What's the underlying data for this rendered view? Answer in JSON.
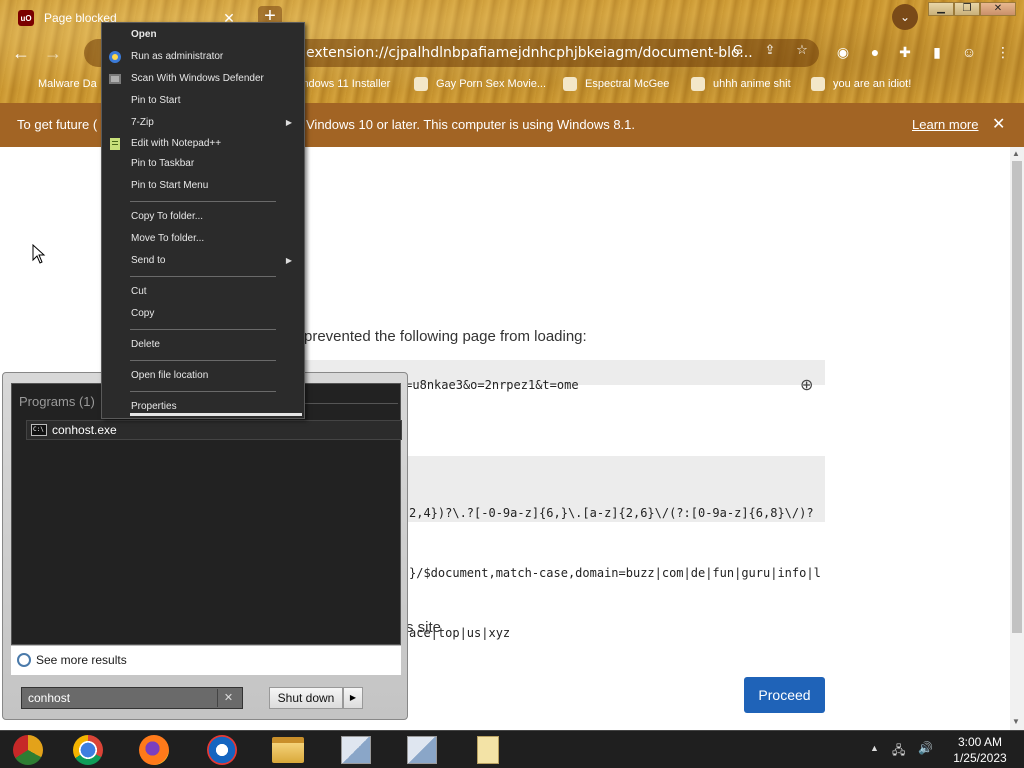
{
  "browser": {
    "tab_title": "Page blocked",
    "tab_icon": "uBlock Origin",
    "new_tab_label": "+",
    "address": "extension://cjpalhdlnbpafiamejdnhcphjbkeiagm/document-blo...",
    "bookmarks": [
      "Malware Da",
      "indows 11 Installer",
      "Gay Porn Sex Movie...",
      "Espectral McGee",
      "uhhh anime shit",
      "you are an idiot!"
    ]
  },
  "infobar": {
    "text_left": "To get future (",
    "text": "Vindows 10 or later. This computer is using Windows 8.1.",
    "learn_more": "Learn more",
    "close": "✕"
  },
  "page": {
    "prevented_text": "prevented the following page from loading:",
    "blocked_url": "4u.life/?u=u8nkae3&o=2nrpez1&t=ome",
    "filter_lines": [
      "2,4})?\\.?[-0-9a-z]{6,}\\.[a-z]{2,6}\\/(?:[0-9a-z]{6,8}\\/)?",
      "}/$document,match-case,domain=buzz|com|de|fun|guru|info|l",
      "ace|top|us|xyz"
    ],
    "site_text": "s site",
    "proceed_label": "Proceed"
  },
  "context_menu": {
    "items": [
      {
        "label": "Open",
        "bold": true
      },
      {
        "label": "Run as administrator",
        "icon": "shield-icon"
      },
      {
        "label": "Scan With Windows Defender",
        "icon": "defender-icon"
      },
      {
        "label": "Pin to Start"
      },
      {
        "label": "7-Zip",
        "submenu": true
      },
      {
        "label": "Edit with Notepad++",
        "icon": "notepadpp-icon"
      },
      {
        "label": "Pin to Taskbar"
      },
      {
        "label": "Pin to Start Menu"
      },
      {
        "label": "Copy To folder..."
      },
      {
        "label": "Move To folder..."
      },
      {
        "label": "Send to",
        "submenu": true
      },
      {
        "label": "Cut"
      },
      {
        "label": "Copy"
      },
      {
        "label": "Delete"
      },
      {
        "label": "Open file location"
      },
      {
        "label": "Properties"
      }
    ]
  },
  "start_menu": {
    "programs_header": "Programs (1)",
    "program_item": "conhost.exe",
    "see_more": "See more results",
    "search_value": "conhost",
    "shutdown_label": "Shut down"
  },
  "taskbar": {
    "apps": [
      "chrome-canary",
      "chrome",
      "firefox",
      "office",
      "file-explorer",
      "network-app",
      "network-app-2",
      "notepad"
    ],
    "time": "3:00 AM",
    "date": "1/25/2023"
  }
}
